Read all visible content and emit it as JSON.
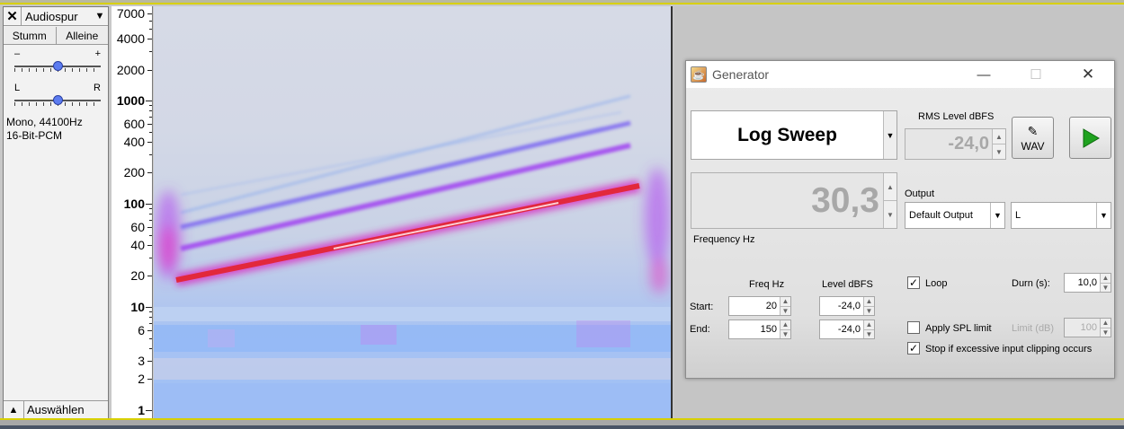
{
  "track": {
    "close_symbol": "✕",
    "name": "Audiospur",
    "menu_arrow": "▼",
    "mute_label": "Stumm",
    "solo_label": "Alleine",
    "gain_minus": "–",
    "gain_plus": "+",
    "gain_level": 0.5,
    "pan_left": "L",
    "pan_right": "R",
    "pan_level": 0.5,
    "info_line1": "Mono, 44100Hz",
    "info_line2": "16-Bit-PCM",
    "collapse_arrow": "▲",
    "select_label": "Auswählen"
  },
  "ruler": {
    "labels": [
      {
        "text": "7000",
        "bold": false
      },
      {
        "text": "4000",
        "bold": false
      },
      {
        "text": "2000",
        "bold": false
      },
      {
        "text": "1000",
        "bold": true
      },
      {
        "text": "600",
        "bold": false
      },
      {
        "text": "400",
        "bold": false
      },
      {
        "text": "200",
        "bold": false
      },
      {
        "text": "100",
        "bold": true
      },
      {
        "text": "60",
        "bold": false
      },
      {
        "text": "40",
        "bold": false
      },
      {
        "text": "20",
        "bold": false
      },
      {
        "text": "10",
        "bold": true
      },
      {
        "text": "6",
        "bold": false
      },
      {
        "text": "3",
        "bold": false
      },
      {
        "text": "2",
        "bold": false
      },
      {
        "text": "1",
        "bold": true
      }
    ]
  },
  "generator": {
    "title": "Generator",
    "app_icon": "☕",
    "minimize_symbol": "—",
    "maximize_symbol": "☐",
    "close_symbol": "✕",
    "signal_type": "Log Sweep",
    "frequency_value": "30,3",
    "frequency_label": "Frequency Hz",
    "rms_label": "RMS Level dBFS",
    "rms_value": "-24,0",
    "wav_label": "WAV",
    "output_label": "Output",
    "output_device": "Default Output",
    "output_channel": "L",
    "freq_col_label": "Freq Hz",
    "level_col_label": "Level dBFS",
    "start_label": "Start:",
    "end_label": "End:",
    "start_freq": "20",
    "end_freq": "150",
    "start_level": "-24,0",
    "end_level": "-24,0",
    "loop_label": "Loop",
    "loop_checked": true,
    "durn_label": "Durn (s):",
    "durn_value": "10,0",
    "spl_label": "Apply SPL limit",
    "spl_checked": false,
    "limit_label": "Limit (dB)",
    "limit_value": "100",
    "clip_label": "Stop if excessive input clipping occurs",
    "clip_checked": true,
    "accent_color": "#1fa21f"
  }
}
